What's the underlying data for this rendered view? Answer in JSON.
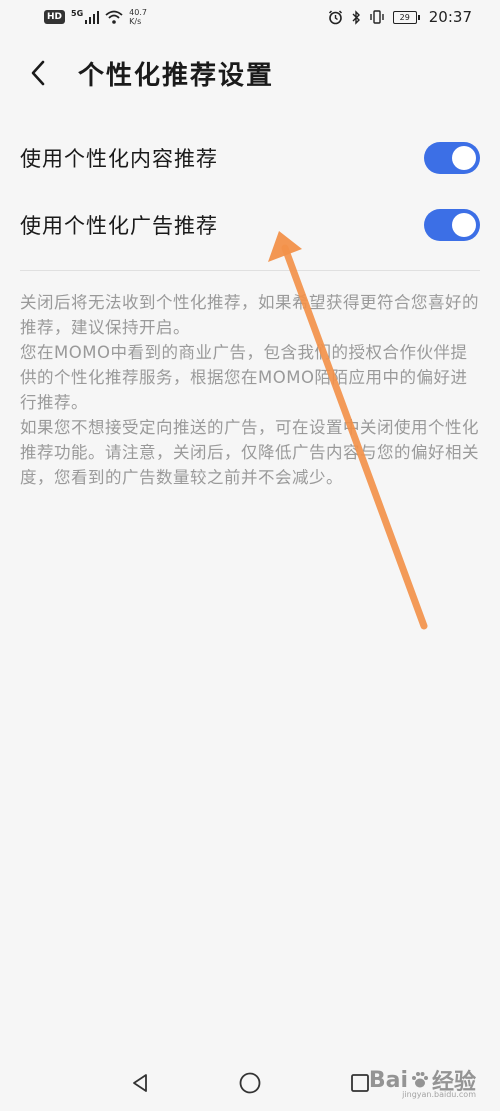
{
  "status_bar": {
    "hd": "HD",
    "network": "5G",
    "speed_value": "40.7",
    "speed_unit": "K/s",
    "battery": "29",
    "time": "20:37"
  },
  "header": {
    "title": "个性化推荐设置"
  },
  "settings": [
    {
      "label": "使用个性化内容推荐",
      "enabled": true
    },
    {
      "label": "使用个性化广告推荐",
      "enabled": true
    }
  ],
  "description": [
    "关闭后将无法收到个性化推荐，如果希望获得更符合您喜好的推荐，建议保持开启。",
    "您在MOMO中看到的商业广告，包含我们的授权合作伙伴提供的个性化推荐服务，根据您在MOMO陌陌应用中的偏好进行推荐。",
    "如果您不想接受定向推送的广告，可在设置中关闭使用个性化推荐功能。请注意，关闭后，仅降低广告内容与您的偏好相关度，您看到的广告数量较之前并不会减少。"
  ],
  "colors": {
    "toggle_on": "#3c6fe6",
    "arrow": "#f2914a",
    "description_text": "#9a9a9a"
  },
  "watermark": {
    "brand": "Bai",
    "brand_cn": "经验",
    "url": "jingyan.baidu.com"
  }
}
